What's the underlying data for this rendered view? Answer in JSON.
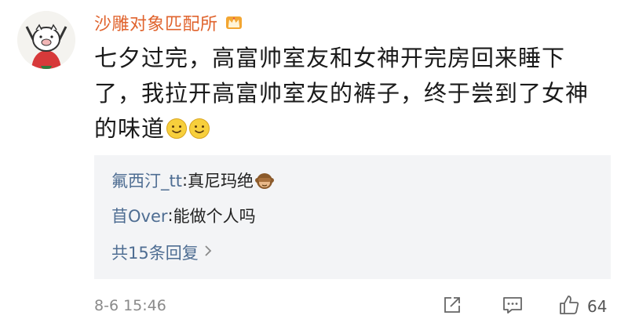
{
  "comment": {
    "username": "沙雕对象匹配所",
    "badge_icon": "crown-icon",
    "body_text": "七夕过完，高富帅室友和女神开完房回来睡下了，我拉开高富帅室友的裤子，终于尝到了女神的味道",
    "body_emojis": [
      "smile-emoji",
      "smile-emoji"
    ],
    "replies": [
      {
        "name": "氟西汀_tt",
        "separator": ": ",
        "text": "真尼玛绝",
        "emoji": "see-no-evil-monkey-emoji"
      },
      {
        "name": "苜Over",
        "separator": ": ",
        "text": "能做个人吗"
      }
    ],
    "more_replies_label": "共15条回复",
    "timestamp": "8-6 15:46",
    "like_count": "64"
  },
  "colors": {
    "username": "#e0632d",
    "reply_name": "#4e6d92",
    "reply_box_bg": "#f3f4f6",
    "meta_text": "#8a8a8a"
  }
}
